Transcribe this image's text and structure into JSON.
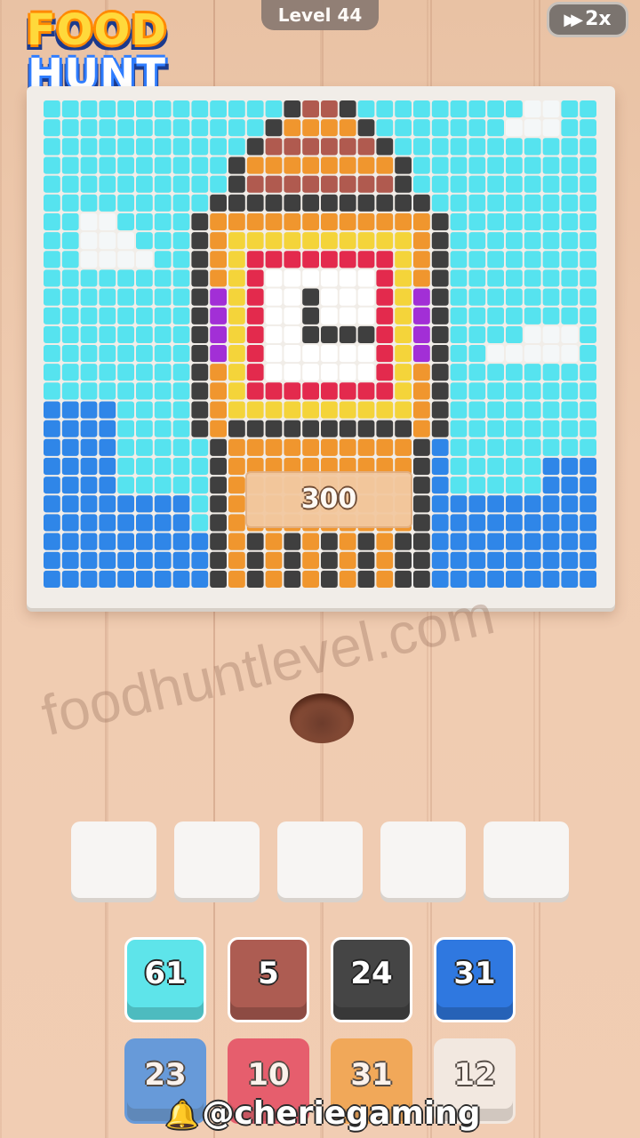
{
  "header": {
    "logo_line1": "FOOD",
    "logo_line2": "HUNT",
    "level_label": "Level 44",
    "speed_icon": "fast-forward-icon",
    "speed_label": "2x"
  },
  "board": {
    "price": "300",
    "palette": {
      "sky": "#56e3ef",
      "cloud": "#f4f7f8",
      "water": "#2f86e8",
      "dark": "#3f3f3f",
      "orange": "#f0962e",
      "brick": "#b05a4f",
      "yellow": "#f4d43a",
      "red": "#e32a4d",
      "purple": "#a22fd6",
      "white": "#ffffff"
    }
  },
  "watermark": "foodhuntlevel.com",
  "slots": [
    "",
    "",
    "",
    "",
    ""
  ],
  "tiles": [
    {
      "value": "61",
      "color": "#5ee4ea"
    },
    {
      "value": "5",
      "color": "#ad5c52"
    },
    {
      "value": "24",
      "color": "#454545"
    },
    {
      "value": "31",
      "color": "#2f78e0"
    },
    {
      "value": "23",
      "color": "#3a8ae6"
    },
    {
      "value": "10",
      "color": "#e33a56"
    },
    {
      "value": "31",
      "color": "#f29c3c"
    },
    {
      "value": "12",
      "color": "#f3f1ef"
    }
  ],
  "credit": "@cheriegaming"
}
